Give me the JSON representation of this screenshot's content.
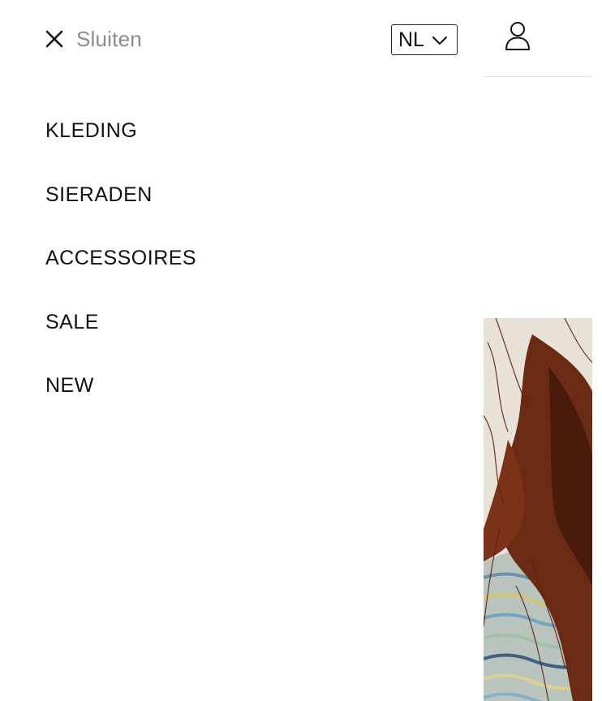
{
  "drawer": {
    "close_label": "Sluiten",
    "close_icon": "close-icon",
    "language": {
      "selected": "NL",
      "icon": "chevron-down-icon"
    },
    "nav_items": [
      {
        "label": "KLEDING"
      },
      {
        "label": "SIERADEN"
      },
      {
        "label": "ACCESSOIRES"
      },
      {
        "label": "SALE"
      },
      {
        "label": "NEW"
      }
    ]
  },
  "background": {
    "account_icon": "user-icon",
    "hero_image": "hero-model-photo"
  },
  "colors": {
    "text": "#111111",
    "muted_text": "#8c8c8c",
    "border": "#222222",
    "divider": "#e2e2e2",
    "background": "#ffffff"
  }
}
